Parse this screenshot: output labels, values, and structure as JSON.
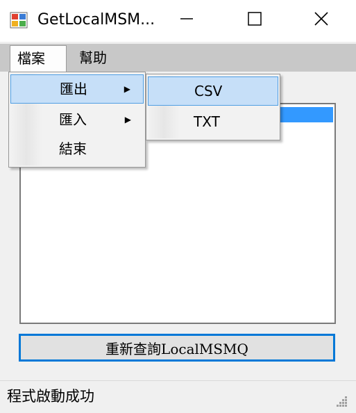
{
  "window": {
    "title": "GetLocalMSM...",
    "minimize_glyph": "—",
    "maximize_glyph": "☐",
    "close_glyph": "✕"
  },
  "menubar": {
    "items": [
      {
        "label": "檔案"
      },
      {
        "label": "幫助"
      }
    ]
  },
  "file_menu": {
    "items": [
      {
        "label": "匯出",
        "submenu": true
      },
      {
        "label": "匯入",
        "submenu": true
      },
      {
        "label": "結束",
        "submenu": false
      }
    ]
  },
  "export_submenu": {
    "items": [
      {
        "label": "CSV"
      },
      {
        "label": "TXT"
      }
    ]
  },
  "main": {
    "requery_button": "重新查詢LocalMSMQ"
  },
  "status": {
    "text": "程式啟動成功"
  },
  "colors": {
    "accent": "#0078d7",
    "menu_highlight": "#c6dff8",
    "list_selection": "#3399ff"
  }
}
